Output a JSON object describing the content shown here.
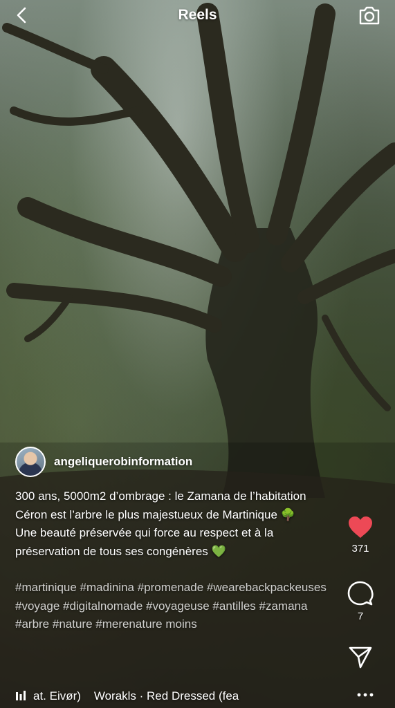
{
  "header": {
    "title": "Reels",
    "back_icon": "chevron-left-icon",
    "camera_icon": "camera-icon"
  },
  "post": {
    "username": "angeliquerobinformation",
    "caption_line1": "300 ans, 5000m2 d’ombrage : le Zamana de l’habitation Céron est l’arbre le plus majestueux de Martinique",
    "caption_emoji1": "🌳",
    "caption_line2": "Une beauté préservée qui force au respect et à la préservation de tous ses congénères",
    "caption_emoji2": "💚",
    "hashtags": "#martinique #madinina #promenade #wearebackpackeuses #voyage #digitalnomade #voyageuse #antilles #zamana #arbre #nature #merenature",
    "more_label": "moins"
  },
  "actions": {
    "likes": "371",
    "comments": "7",
    "like_color": "#ed4956"
  },
  "audio": {
    "track": "at. Eivør)    Worakls · Red Dressed (fea"
  }
}
